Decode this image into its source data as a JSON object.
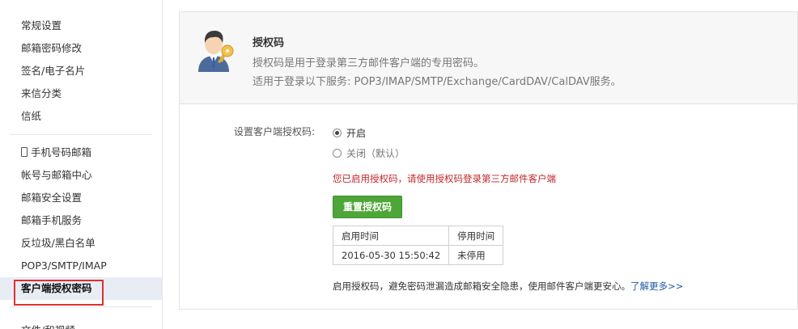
{
  "sidebar": {
    "group1": [
      {
        "label": "常规设置"
      },
      {
        "label": "邮箱密码修改"
      },
      {
        "label": "签名/电子名片"
      },
      {
        "label": "来信分类"
      },
      {
        "label": "信纸"
      }
    ],
    "group2": [
      {
        "label": "手机号码邮箱",
        "icon": "phone-icon"
      },
      {
        "label": "帐号与邮箱中心"
      },
      {
        "label": "邮箱安全设置"
      },
      {
        "label": "邮箱手机服务"
      },
      {
        "label": "反垃圾/黑白名单"
      },
      {
        "label": "POP3/SMTP/IMAP"
      },
      {
        "label": "客户端授权密码",
        "active": true
      }
    ],
    "cut_item": "文件/和视频"
  },
  "panel": {
    "title": "授权码",
    "desc1": "授权码是用于登录第三方邮件客户端的专用密码。",
    "desc2": "适用于登录以下服务: POP3/IMAP/SMTP/Exchange/CardDAV/CalDAV服务。",
    "setting_label": "设置客户端授权码:",
    "option_on": "开启",
    "option_off": "关闭（默认）",
    "selected": "开启",
    "warning": "您已启用授权码，请使用授权码登录第三方邮件客户端",
    "reset_button": "重置授权码",
    "table": {
      "headers": [
        "启用时间",
        "停用时间"
      ],
      "rows": [
        [
          "2016-05-30 15:50:42",
          "未停用"
        ]
      ]
    },
    "footer_text": "启用授权码，避免密码泄漏造成邮箱安全隐患，使用邮件客户端更安心。",
    "footer_link": "了解更多>>"
  },
  "colors": {
    "accent_green": "#4ea638",
    "warning_red": "#c0282b",
    "link_blue": "#1d5aa8",
    "highlight_red": "#e03030"
  }
}
